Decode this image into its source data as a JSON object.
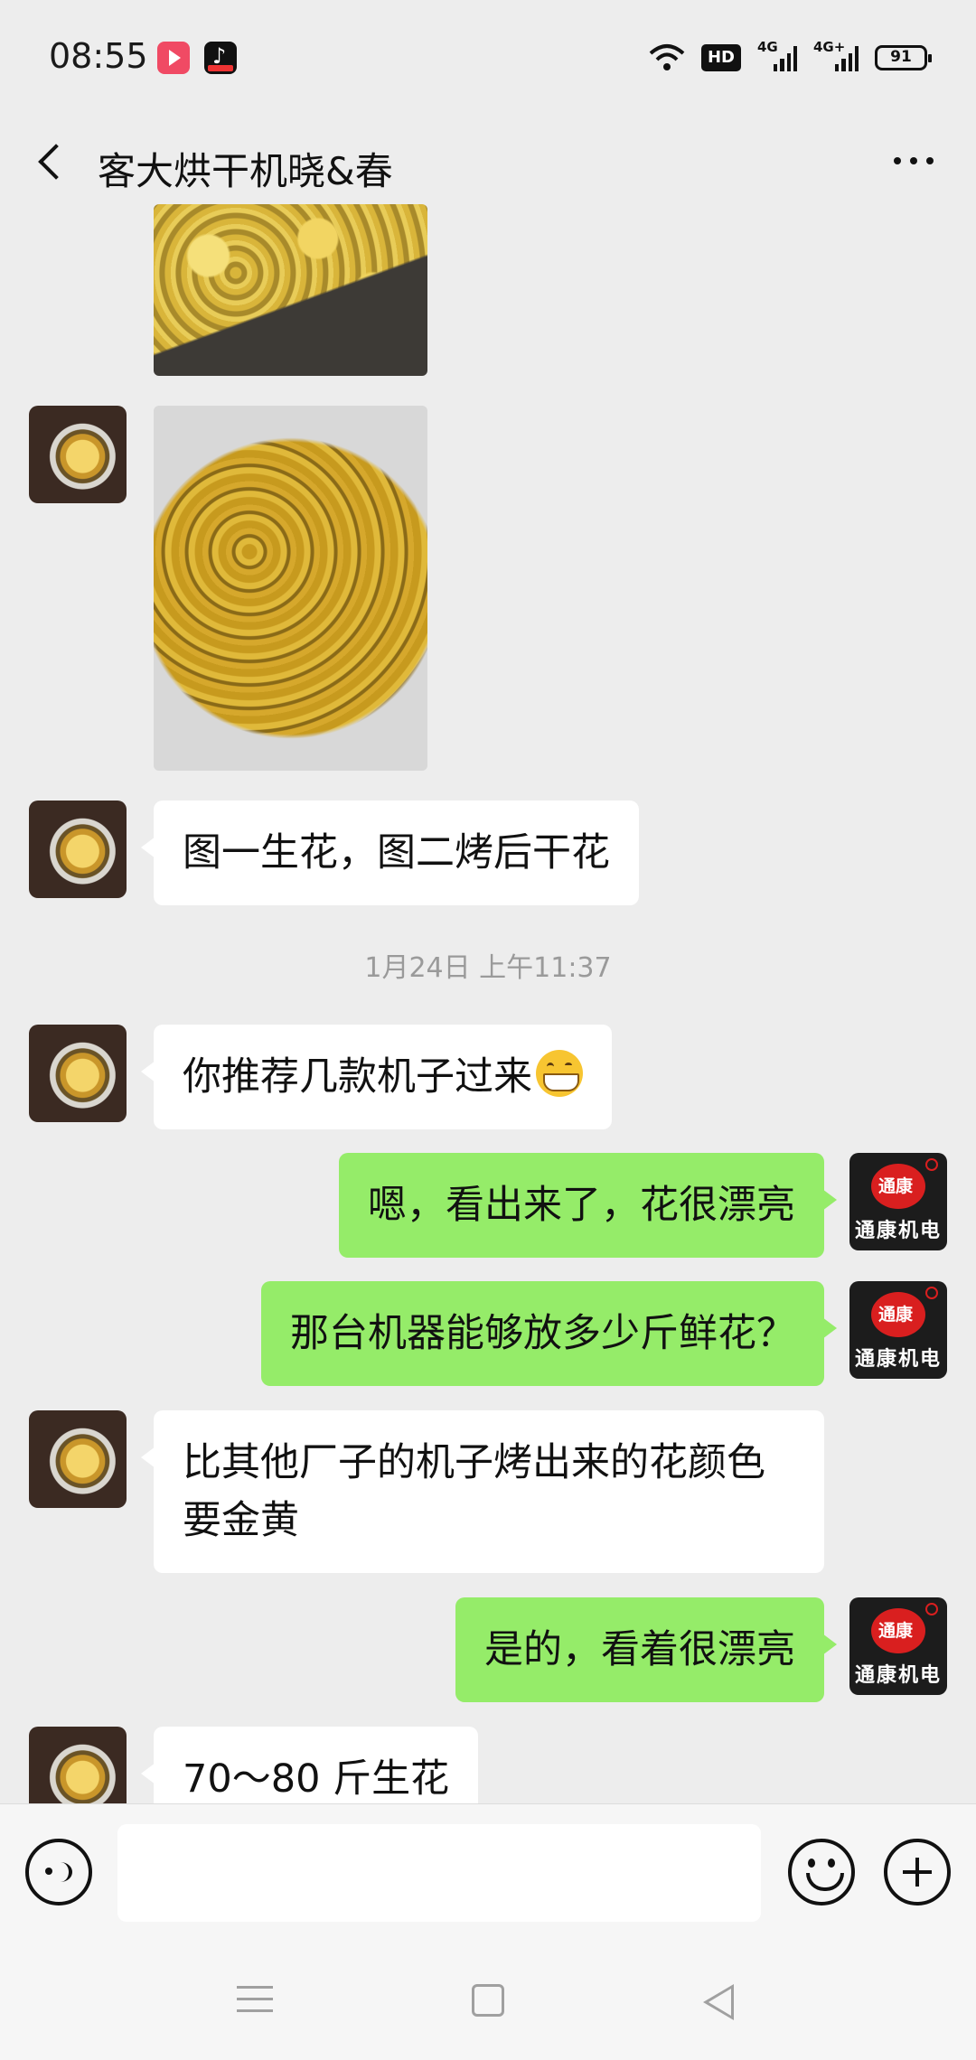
{
  "status_bar": {
    "time": "08:55",
    "hd_label": "HD",
    "network_1": "4G",
    "network_2": "4G+",
    "battery": "91",
    "icons": [
      "video-app-icon",
      "tiktok-icon",
      "wifi-icon",
      "hd-icon",
      "signal-icon",
      "signal-icon",
      "battery-icon"
    ]
  },
  "header": {
    "title": "客大烘干机晓&春",
    "back_icon": "chevron-left-icon",
    "more_icon": "more-dots-icon"
  },
  "messages": [
    {
      "side": "in",
      "type": "image",
      "content": "dried flowers photo (partially visible)"
    },
    {
      "side": "in",
      "type": "image",
      "content": "fresh flowers photo"
    },
    {
      "side": "in",
      "type": "text",
      "text": "图一生花，图二烤后干花"
    },
    {
      "type": "timestamp",
      "text": "1月24日 上午11:37"
    },
    {
      "side": "in",
      "type": "text",
      "text": "你推荐几款机子过来",
      "emoji": "grinning-face-icon"
    },
    {
      "side": "out",
      "type": "text",
      "text": "嗯，看出来了，花很漂亮"
    },
    {
      "side": "out",
      "type": "text",
      "text": "那台机器能够放多少斤鲜花？"
    },
    {
      "side": "in",
      "type": "text",
      "line1": "比其他厂子的机子烤出来的花颜色",
      "line2": "要金黄"
    },
    {
      "side": "out",
      "type": "text",
      "text": "是的，看着很漂亮"
    },
    {
      "side": "in",
      "type": "text",
      "text": "70～80 斤生花"
    }
  ],
  "avatars": {
    "outgoing_logo_text": "通康机电"
  },
  "input_bar": {
    "placeholder": "",
    "voice_icon": "voice-icon",
    "emoji_icon": "emoji-icon",
    "plus_icon": "plus-icon"
  },
  "colors": {
    "background": "#ededed",
    "outgoing_bubble": "#95ec69",
    "incoming_bubble": "#ffffff",
    "timestamp": "#9a9a9a"
  }
}
